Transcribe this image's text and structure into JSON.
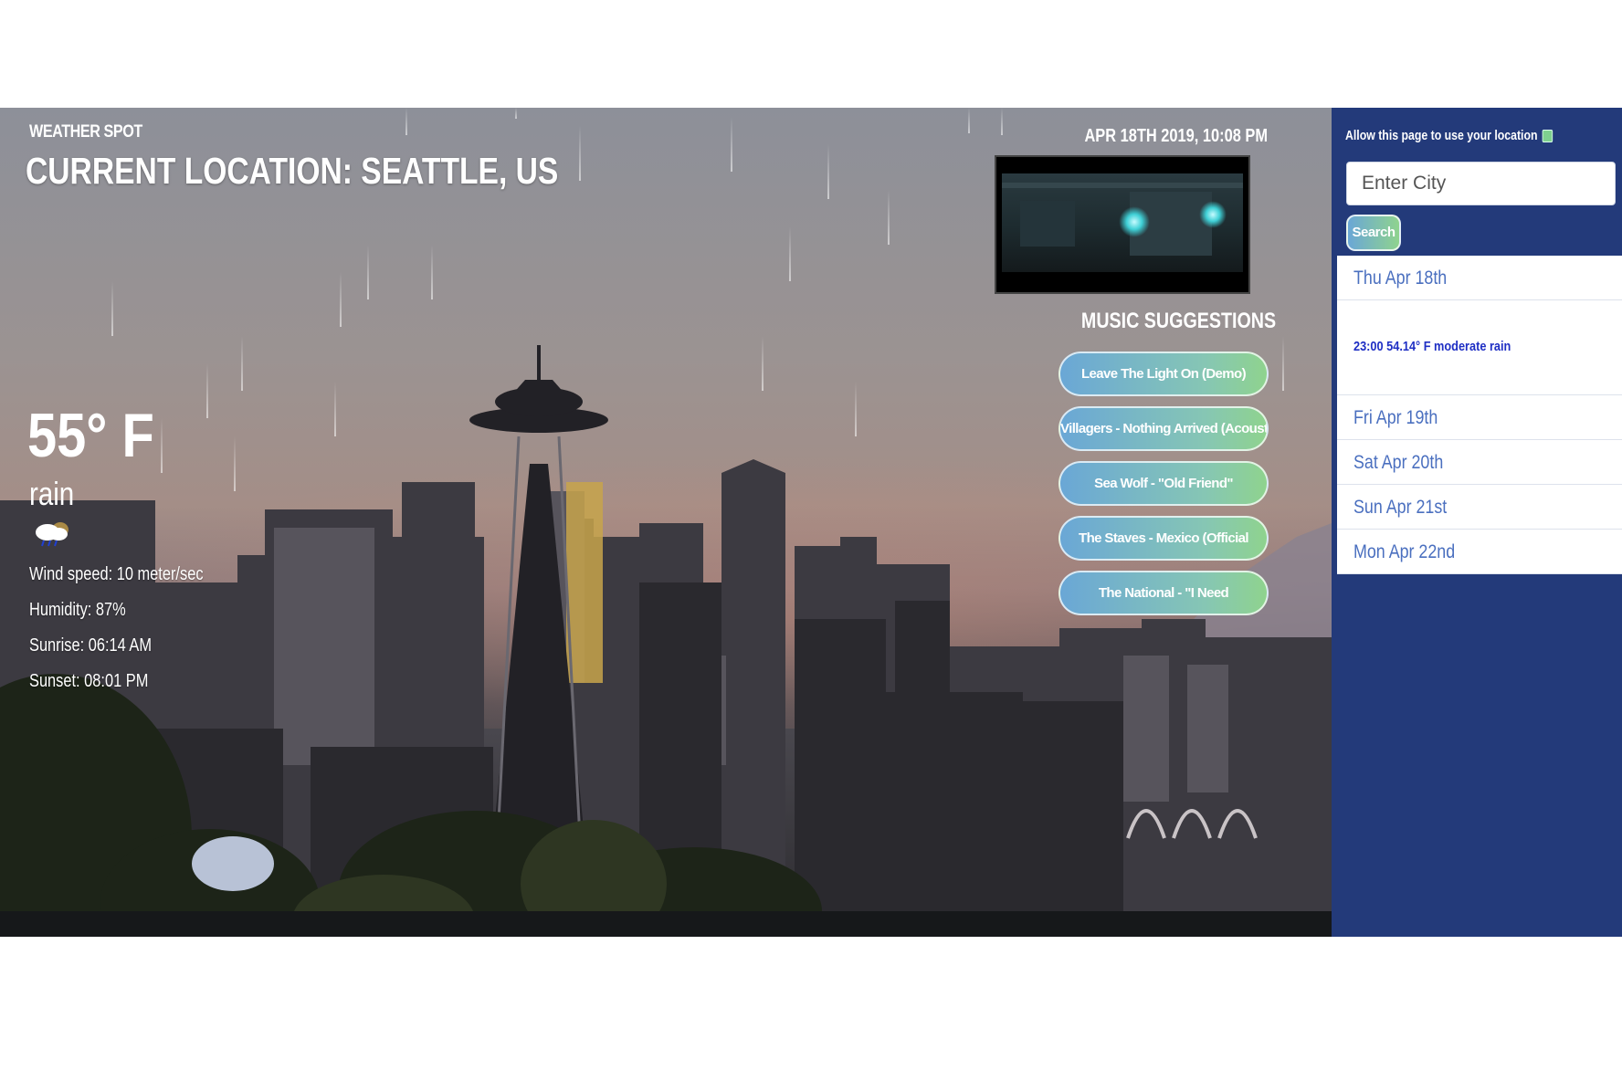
{
  "app": {
    "brand": "WEATHER SPOT",
    "location_title": "CURRENT LOCATION: SEATTLE, US",
    "datetime": "APR 18TH 2019, 10:08 PM"
  },
  "weather": {
    "temperature": "55° F",
    "condition": "rain",
    "icon": "rain-cloud-icon",
    "wind_speed": "Wind speed: 10 meter/sec",
    "humidity": "Humidity: 87%",
    "sunrise": "Sunrise: 06:14 AM",
    "sunset": "Sunset: 08:01 PM"
  },
  "music": {
    "title": "MUSIC SUGGESTIONS",
    "suggestions": [
      "Leave The Light On (Demo)",
      "Villagers - Nothing Arrived (Acoustic)",
      "Sea Wolf - \"Old Friend\"",
      "The Staves - Mexico (Official",
      "The National - \"I Need"
    ]
  },
  "sidebar": {
    "geo_label": "Allow this page to use your location",
    "geo_checked": true,
    "city_placeholder": "Enter City",
    "search_label": "Search",
    "forecast": [
      {
        "label": "Thu Apr 18th",
        "detail": "23:00 54.14° F moderate rain"
      },
      {
        "label": "Fri Apr 19th"
      },
      {
        "label": "Sat Apr 20th"
      },
      {
        "label": "Sun Apr 21st"
      },
      {
        "label": "Mon Apr 22nd"
      }
    ]
  },
  "colors": {
    "sidebar_bg": "#233a7a",
    "forecast_text": "#4a6fbf",
    "forecast_detail": "#1f2fc4",
    "button_gradient_start": "#6aa7d6",
    "button_gradient_end": "#8fd38e"
  }
}
